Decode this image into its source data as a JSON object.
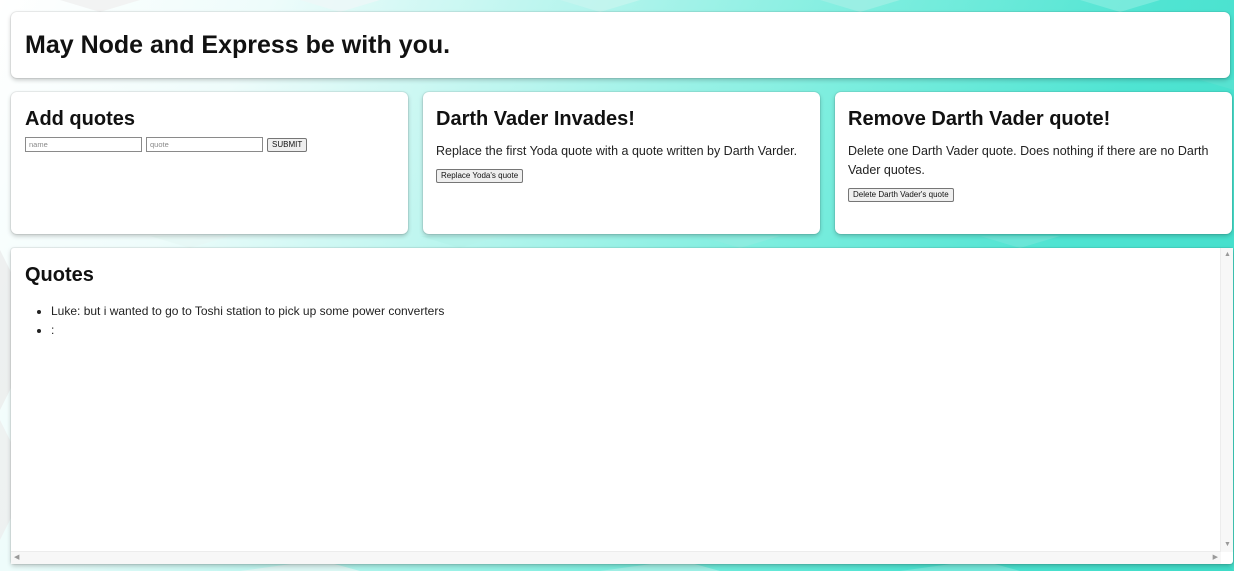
{
  "header": {
    "title": "May Node and Express be with you."
  },
  "add_quotes": {
    "title": "Add quotes",
    "name_placeholder": "name",
    "quote_placeholder": "quote",
    "submit_label": "SUBMIT"
  },
  "darth_vader_invades": {
    "title": "Darth Vader Invades!",
    "description": "Replace the first Yoda quote with a quote written by Darth Varder.",
    "button_label": "Replace Yoda's quote"
  },
  "remove_quote": {
    "title": "Remove Darth Vader quote!",
    "description": "Delete one Darth Vader quote. Does nothing if there are no Darth Vader quotes.",
    "button_label": "Delete Darth Vader's quote"
  },
  "quotes": {
    "title": "Quotes",
    "items": [
      "Luke: but i wanted to go to Toshi station to pick up some power converters",
      ":"
    ]
  },
  "scrollbar": {
    "up_icon": "scroll-up-arrow-icon",
    "down_icon": "scroll-down-arrow-icon",
    "left_icon": "scroll-left-arrow-icon",
    "right_icon": "scroll-right-arrow-icon"
  }
}
